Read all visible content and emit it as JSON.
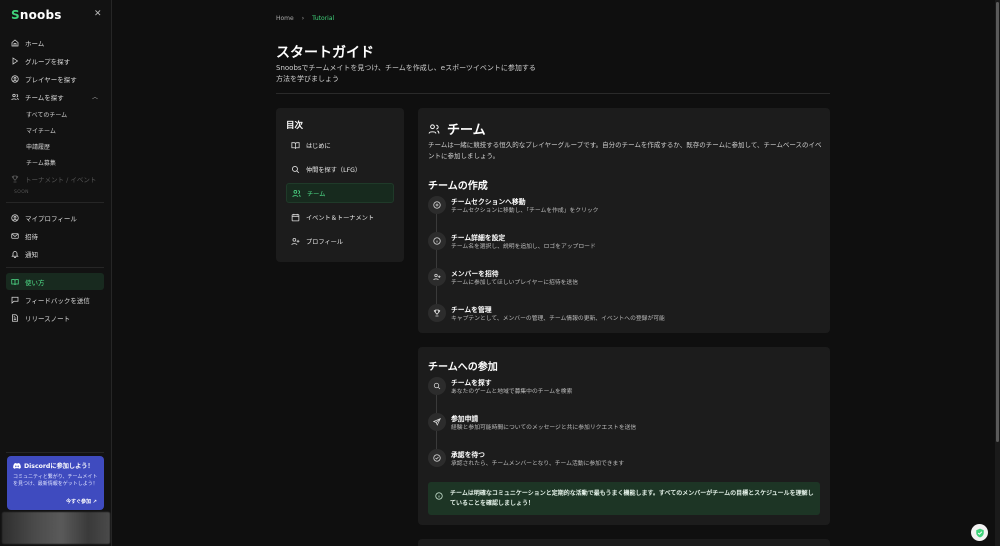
{
  "app": {
    "logo_first": "S",
    "logo_rest": "noobs"
  },
  "sidebar": {
    "items": [
      {
        "label": "ホーム"
      },
      {
        "label": "グループを探す"
      },
      {
        "label": "プレイヤーを探す"
      },
      {
        "label": "チームを探す"
      }
    ],
    "sub_items": [
      {
        "label": "すべてのチーム"
      },
      {
        "label": "マイチーム"
      },
      {
        "label": "申請履歴"
      },
      {
        "label": "チーム募集"
      }
    ],
    "tournament": {
      "label": "トーナメント / イベント",
      "soon": "SOON"
    },
    "account_items": [
      {
        "label": "マイプロフィール"
      },
      {
        "label": "招待"
      },
      {
        "label": "通知"
      }
    ],
    "help_items": [
      {
        "label": "使い方"
      },
      {
        "label": "フィードバックを送信"
      },
      {
        "label": "リリースノート"
      }
    ],
    "discord": {
      "title": "Discordに参加しよう！",
      "desc": "コミュニティと繋がり、チームメイトを見つけ、最新情報をゲットしよう！",
      "link": "今すぐ参加"
    }
  },
  "breadcrumb": {
    "home": "Home",
    "sep": "›",
    "current": "Tutorial"
  },
  "page": {
    "title": "スタートガイド",
    "desc": "Snoobsでチームメイトを見つけ、チームを作成し、eスポーツイベントに参加する方法を学びましょう"
  },
  "toc": {
    "title": "目次",
    "items": [
      {
        "label": "はじめに"
      },
      {
        "label": "仲間を探す（LFG）"
      },
      {
        "label": "チーム"
      },
      {
        "label": "イベント＆トーナメント"
      },
      {
        "label": "プロフィール"
      }
    ]
  },
  "team": {
    "title": "チーム",
    "desc": "チームは一緒に競技する恒久的なプレイヤーグループです。自分のチームを作成するか、既存のチームに参加して、チームベースのイベントに参加しましょう。",
    "create": {
      "title": "チームの作成",
      "steps": [
        {
          "title": "チームセクションへ移動",
          "desc": "チームセクションに移動し、「チームを作成」をクリック",
          "icon": "plus-circle-icon"
        },
        {
          "title": "チーム詳細を設定",
          "desc": "チーム名を選択し、説明を追加し、ロゴをアップロード",
          "icon": "info-icon"
        },
        {
          "title": "メンバーを招待",
          "desc": "チームに参加してほしいプレイヤーに招待を送信",
          "icon": "user-plus-icon"
        },
        {
          "title": "チームを管理",
          "desc": "キャプテンとして、メンバーの管理、チーム情報の更新、イベントへの登録が可能",
          "icon": "trophy-icon"
        }
      ]
    },
    "join": {
      "title": "チームへの参加",
      "steps": [
        {
          "title": "チームを探す",
          "desc": "あなたのゲームと地域で募集中のチームを検索",
          "icon": "search-icon"
        },
        {
          "title": "参加申請",
          "desc": "経験と参加可能時間についてのメッセージと共に参加リクエストを送信",
          "icon": "send-icon"
        },
        {
          "title": "承認を待つ",
          "desc": "承認されたら、チームメンバーとなり、チーム活動に参加できます",
          "icon": "check-circle-icon"
        }
      ],
      "note": "チームは明確なコミュニケーションと定期的な活動で最もうまく機能します。すべてのメンバーがチームの目標とスケジュールを理解していることを確認しましょう！"
    }
  },
  "colors": {
    "accent": "#3fd27a",
    "discord": "#3f4bbf",
    "note_bg": "#1d3525"
  }
}
